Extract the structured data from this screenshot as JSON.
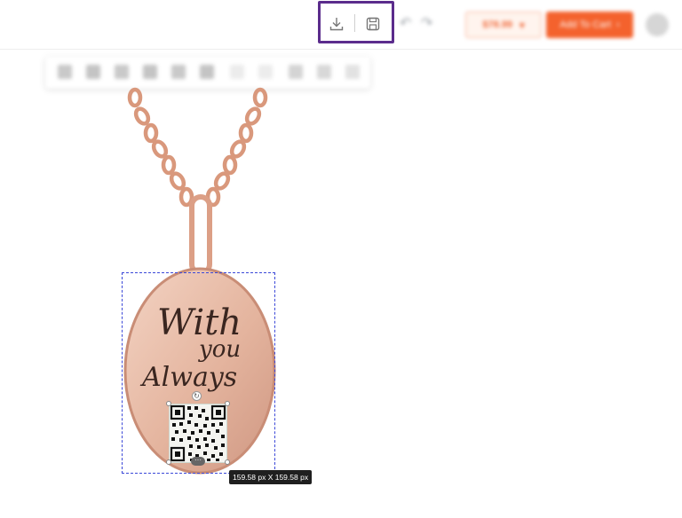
{
  "header": {
    "download_icon": "download-icon",
    "save_icon": "save-icon",
    "undo_icon": "undo-icon",
    "redo_icon": "redo-icon",
    "price_label": "$78.99",
    "price_dropdown_icon": "chevron-down-icon",
    "add_to_cart_label": "Add To Cart",
    "cart_chevron_icon": "chevron-right-icon",
    "avatar_icon": "user-avatar-icon"
  },
  "edit_toolbar": {
    "icons": [
      "align-left-icon",
      "align-center-icon",
      "align-right-icon",
      "align-top-icon",
      "align-middle-icon",
      "align-bottom-icon",
      "flip-horizontal-icon",
      "flip-vertical-icon",
      "duplicate-icon",
      "delete-icon",
      "lock-icon"
    ]
  },
  "canvas": {
    "engraving_line1": "With",
    "engraving_line2": "you",
    "engraving_line3": "Always",
    "qr_code_icon": "qr-code-icon",
    "rotate_handle_icon": "rotate-icon",
    "more_handle_icon": "more-icon",
    "size_tooltip": "159.58 px X 159.58 px"
  },
  "colors": {
    "highlight": "#5b2c8c",
    "accent": "#f4622d",
    "selection": "#3b48d8",
    "rose_gold": "#e6b9a4"
  }
}
